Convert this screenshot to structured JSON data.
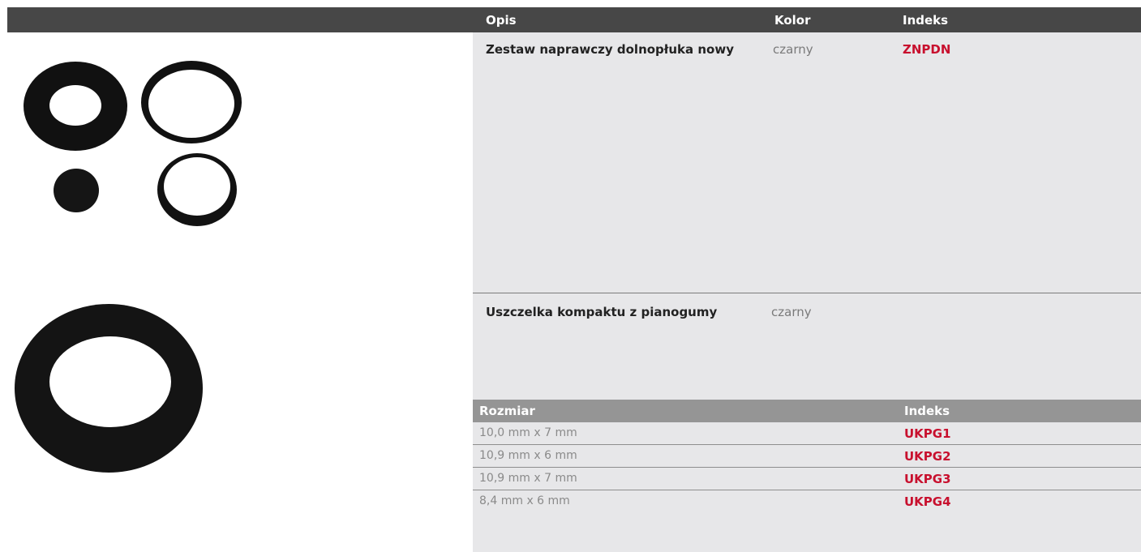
{
  "header": {
    "col_opis": "Opis",
    "col_kolor": "Kolor",
    "col_indeks": "Indeks"
  },
  "product1": {
    "description": "Zestaw naprawczy dolnopłuka nowy",
    "color": "czarny",
    "index": "ZNPDN",
    "image_icon": "rubber-gasket-set-photo"
  },
  "product2": {
    "description": "Uszczelka kompaktu z pianogumy",
    "color": "czarny",
    "image_icon": "foam-rubber-gasket-photo",
    "size_table": {
      "col_size": "Rozmiar",
      "col_index": "Indeks",
      "rows": [
        {
          "size": "10,0 mm x 7 mm",
          "index": "UKPG1"
        },
        {
          "size": "10,9 mm x 6 mm",
          "index": "UKPG2"
        },
        {
          "size": "10,9 mm x 7 mm",
          "index": "UKPG3"
        },
        {
          "size": "8,4 mm x 6 mm",
          "index": "UKPG4"
        }
      ]
    }
  },
  "colors": {
    "accent": "#c8102e",
    "header_bg": "#474747",
    "panel_bg": "#e7e7e9",
    "subheader_bg": "#959595"
  }
}
